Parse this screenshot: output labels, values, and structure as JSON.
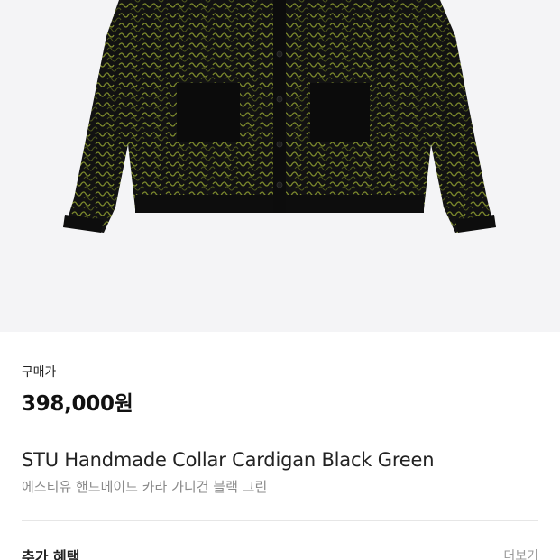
{
  "product": {
    "image_alt": "STU Handmade Collar Cardigan Black Green",
    "price_label": "구매가",
    "price": "398,000원",
    "title": "STU Handmade Collar Cardigan Black Green",
    "subtitle": "에스티유 핸드메이드 카라 가디건 블랙 그린"
  },
  "benefits": {
    "title": "추가 혜택",
    "more_label": "더보기"
  },
  "colors": {
    "image_background": "#f4f4f6",
    "garment": "#121212",
    "knit_accent": "#7d8a2c",
    "subtitle_text": "#8a8a8a"
  }
}
